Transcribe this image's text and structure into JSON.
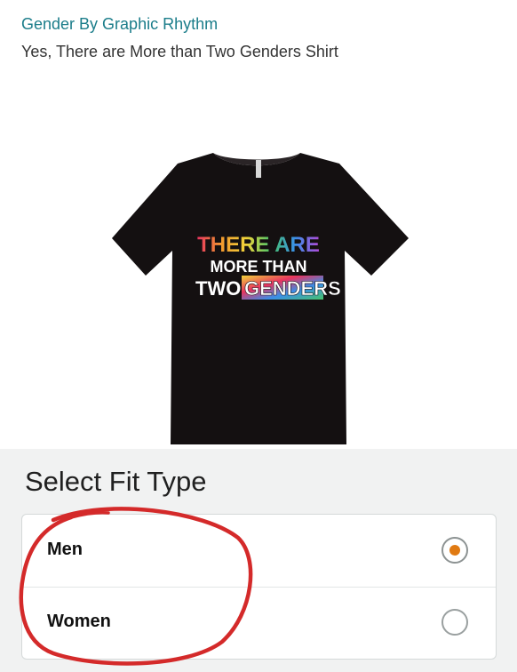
{
  "header": {
    "brand": "Gender By Graphic Rhythm",
    "title": "Yes, There are More than Two Genders Shirt"
  },
  "product_image": {
    "shirt_color": "#141011",
    "print_lines": [
      "THERE ARE",
      "MORE THAN",
      "TWO",
      "GENDERS"
    ]
  },
  "fit": {
    "heading": "Select Fit Type",
    "options": [
      {
        "label": "Men",
        "selected": true
      },
      {
        "label": "Women",
        "selected": false
      }
    ]
  },
  "colors": {
    "brand_link": "#1b7d8a",
    "radio_selected": "#e07a12",
    "annotation": "#d42a2a"
  }
}
